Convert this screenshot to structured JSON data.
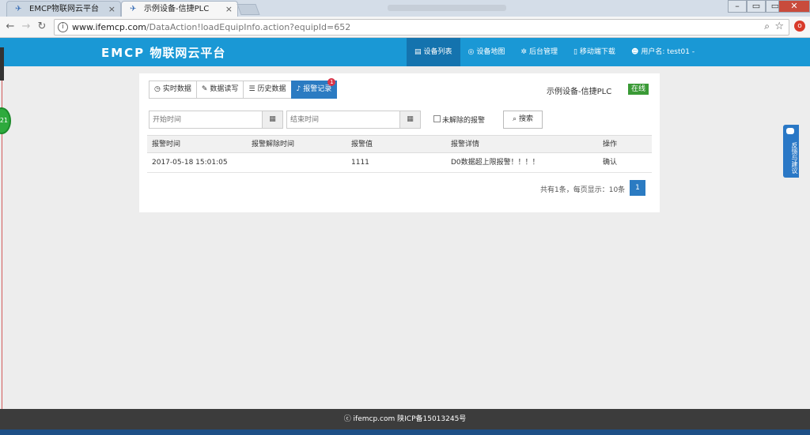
{
  "browser": {
    "tabs": [
      {
        "label": "EMCP物联网云平台",
        "active": false
      },
      {
        "label": "示例设备-信捷PLC",
        "active": true
      }
    ],
    "url_host": "www.ifemcp.com",
    "url_path": "/DataAction!loadEquipInfo.action?equipId=652",
    "close_glyph": "×"
  },
  "header": {
    "logo_brand": "EMCP",
    "logo_text": "物联网云平台",
    "nav": [
      {
        "label": "设备列表",
        "icon": "list-icon",
        "glyph": "▤",
        "active": true
      },
      {
        "label": "设备地图",
        "icon": "globe-icon",
        "glyph": "◎",
        "active": false
      },
      {
        "label": "后台管理",
        "icon": "gears-icon",
        "glyph": "✲",
        "active": false
      },
      {
        "label": "移动端下载",
        "icon": "mobile-icon",
        "glyph": "▯",
        "active": false
      },
      {
        "label": "用户名: test01 -",
        "icon": "user-icon",
        "glyph": "☻",
        "active": false
      }
    ]
  },
  "panel": {
    "tabs": [
      {
        "label": "实时数据",
        "glyph": "◷"
      },
      {
        "label": "数据读写",
        "glyph": "✎"
      },
      {
        "label": "历史数据",
        "glyph": "☰"
      },
      {
        "label": "报警记录",
        "glyph": "♪",
        "badge": "1",
        "active": true
      }
    ],
    "device_name": "示例设备-信捷PLC",
    "status": "在线",
    "filter": {
      "start_placeholder": "开始时间",
      "end_placeholder": "结束时间",
      "checkbox_label": "未解除的报警",
      "search_label": "搜索",
      "search_glyph": "⌕",
      "cal_glyph": "▦"
    },
    "table": {
      "headers": [
        "报警时间",
        "报警解除时间",
        "报警值",
        "报警详情",
        "操作"
      ],
      "rows": [
        [
          "2017-05-18 15:01:05",
          "",
          "1111",
          "D0数据超上限报警！！！！",
          "确认"
        ]
      ]
    },
    "pagination": {
      "summary": "共有1条，每页显示：10条",
      "current_page": "1"
    }
  },
  "feedback_label": "反馈与建议",
  "footer_text": "ⓒ ifemcp.com 陕ICP备15013245号",
  "left_badge": "21",
  "ext_badge": "o"
}
